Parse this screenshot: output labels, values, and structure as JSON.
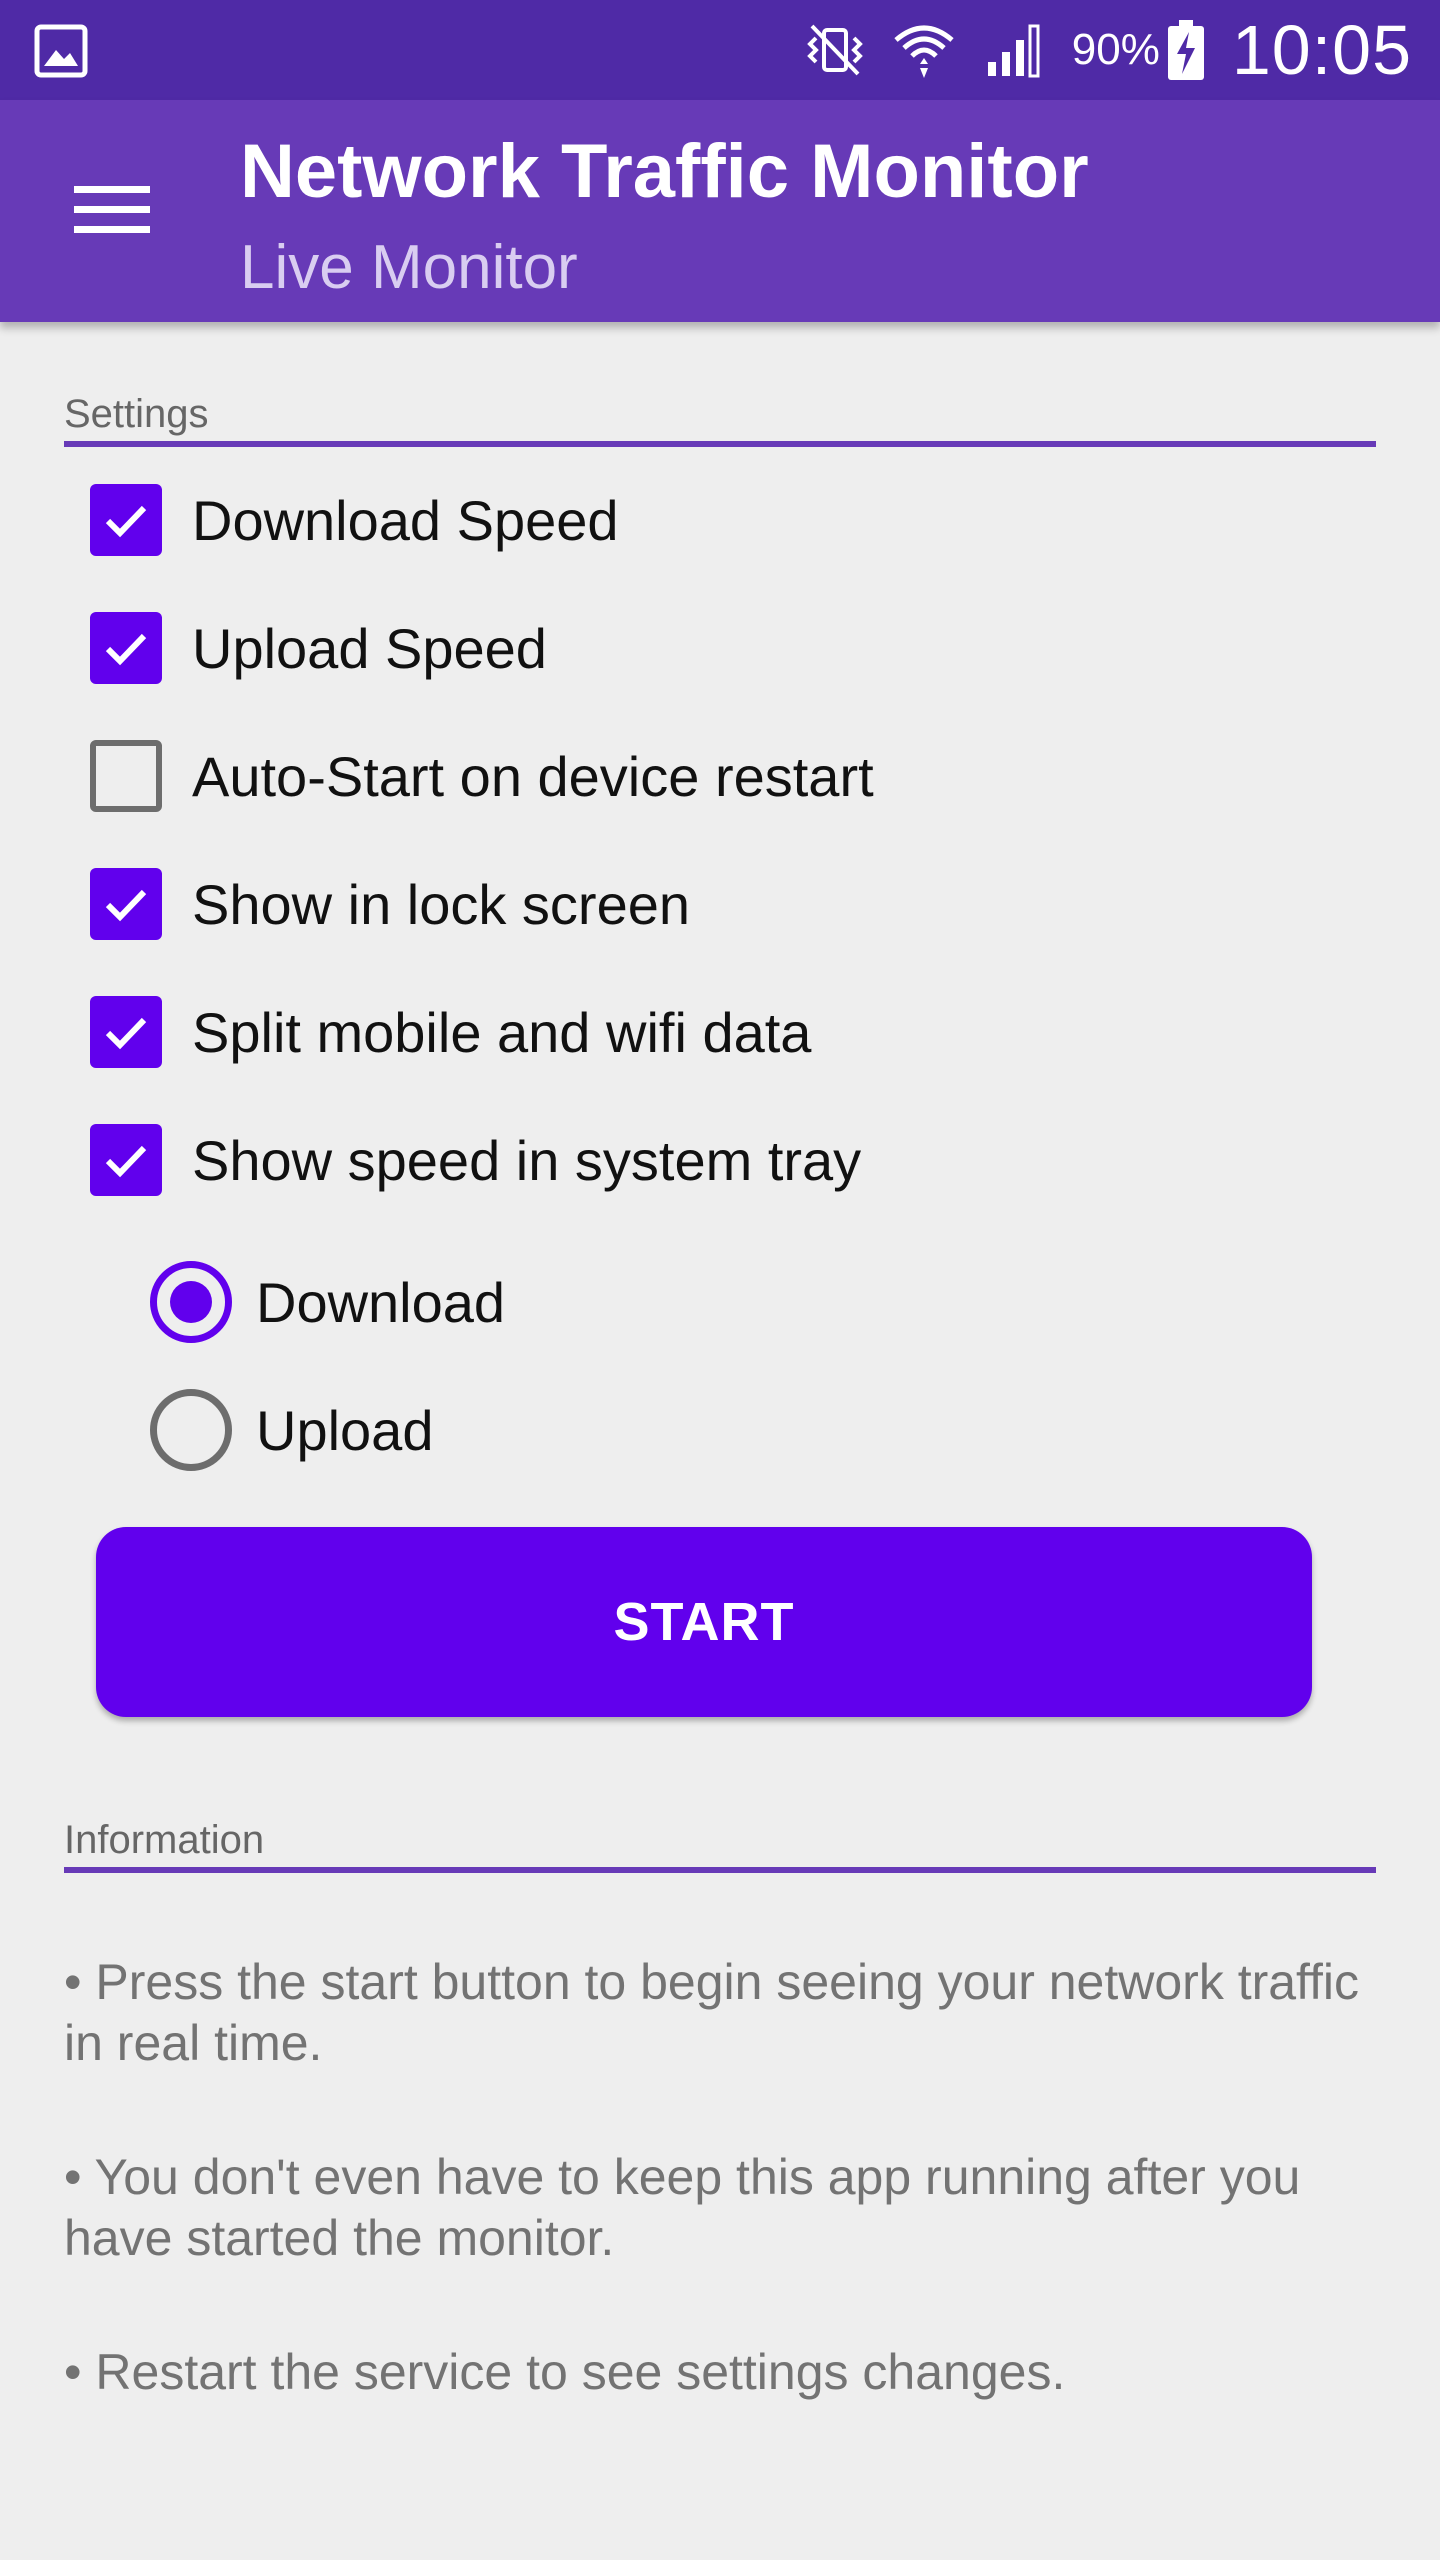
{
  "status_bar": {
    "battery_percent": "90%",
    "time": "10:05",
    "icons": [
      "gallery-icon",
      "vibrate-icon",
      "wifi-icon",
      "signal-icon",
      "battery-charging-icon"
    ]
  },
  "app_bar": {
    "title": "Network Traffic Monitor",
    "subtitle": "Live Monitor",
    "menu_icon": "hamburger-menu-icon"
  },
  "settings": {
    "header": "Settings",
    "options": [
      {
        "label": "Download Speed",
        "checked": true
      },
      {
        "label": "Upload Speed",
        "checked": true
      },
      {
        "label": "Auto-Start on device restart",
        "checked": false
      },
      {
        "label": "Show in lock screen",
        "checked": true
      },
      {
        "label": "Split mobile and wifi data",
        "checked": true
      },
      {
        "label": "Show speed in system tray",
        "checked": true
      }
    ],
    "tray_mode": [
      {
        "label": "Download",
        "selected": true
      },
      {
        "label": "Upload",
        "selected": false
      }
    ],
    "start_label": "START"
  },
  "information": {
    "header": "Information",
    "items": [
      "• Press the start button to begin seeing your network traffic in real time.",
      "• You don't even have to keep this app running after you have started the monitor.",
      "• Restart the service to see settings changes."
    ]
  },
  "colors": {
    "status_bar": "#4f2aa6",
    "app_bar": "#673ab7",
    "accent": "#6100ed",
    "background": "#eeeeee"
  }
}
